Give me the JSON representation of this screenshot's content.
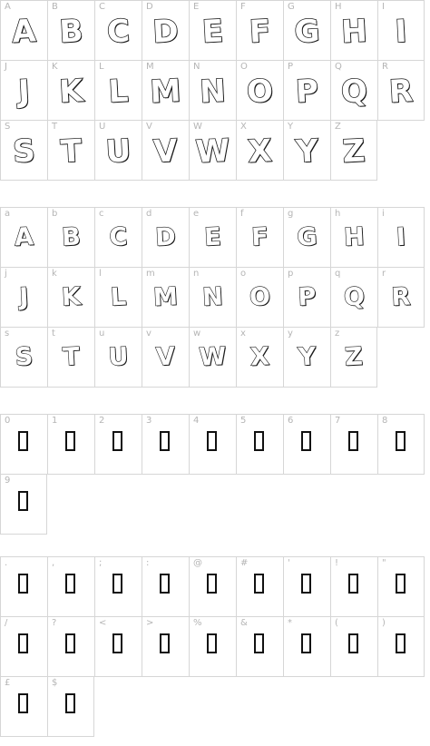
{
  "sections": [
    {
      "name": "uppercase-large",
      "glyph_size": "large",
      "cells": [
        {
          "key": "A",
          "glyph": "A"
        },
        {
          "key": "B",
          "glyph": "B"
        },
        {
          "key": "C",
          "glyph": "C"
        },
        {
          "key": "D",
          "glyph": "D"
        },
        {
          "key": "E",
          "glyph": "E"
        },
        {
          "key": "F",
          "glyph": "F"
        },
        {
          "key": "G",
          "glyph": "G"
        },
        {
          "key": "H",
          "glyph": "H"
        },
        {
          "key": "I",
          "glyph": "I"
        },
        {
          "key": "J",
          "glyph": "J"
        },
        {
          "key": "K",
          "glyph": "K"
        },
        {
          "key": "L",
          "glyph": "L"
        },
        {
          "key": "M",
          "glyph": "M"
        },
        {
          "key": "N",
          "glyph": "N"
        },
        {
          "key": "O",
          "glyph": "O"
        },
        {
          "key": "P",
          "glyph": "P"
        },
        {
          "key": "Q",
          "glyph": "Q"
        },
        {
          "key": "R",
          "glyph": "R"
        },
        {
          "key": "S",
          "glyph": "S"
        },
        {
          "key": "T",
          "glyph": "T"
        },
        {
          "key": "U",
          "glyph": "U"
        },
        {
          "key": "V",
          "glyph": "V"
        },
        {
          "key": "W",
          "glyph": "W"
        },
        {
          "key": "X",
          "glyph": "X"
        },
        {
          "key": "Y",
          "glyph": "Y"
        },
        {
          "key": "Z",
          "glyph": "Z"
        }
      ]
    },
    {
      "name": "lowercase-small",
      "glyph_size": "small",
      "cells": [
        {
          "key": "a",
          "glyph": "A"
        },
        {
          "key": "b",
          "glyph": "B"
        },
        {
          "key": "c",
          "glyph": "C"
        },
        {
          "key": "d",
          "glyph": "D"
        },
        {
          "key": "e",
          "glyph": "E"
        },
        {
          "key": "f",
          "glyph": "F"
        },
        {
          "key": "g",
          "glyph": "G"
        },
        {
          "key": "h",
          "glyph": "H"
        },
        {
          "key": "i",
          "glyph": "I"
        },
        {
          "key": "j",
          "glyph": "J"
        },
        {
          "key": "k",
          "glyph": "K"
        },
        {
          "key": "l",
          "glyph": "L"
        },
        {
          "key": "m",
          "glyph": "M"
        },
        {
          "key": "n",
          "glyph": "N"
        },
        {
          "key": "o",
          "glyph": "O"
        },
        {
          "key": "p",
          "glyph": "P"
        },
        {
          "key": "q",
          "glyph": "Q"
        },
        {
          "key": "r",
          "glyph": "R"
        },
        {
          "key": "s",
          "glyph": "S"
        },
        {
          "key": "t",
          "glyph": "T"
        },
        {
          "key": "u",
          "glyph": "U"
        },
        {
          "key": "v",
          "glyph": "V"
        },
        {
          "key": "w",
          "glyph": "W"
        },
        {
          "key": "x",
          "glyph": "X"
        },
        {
          "key": "y",
          "glyph": "Y"
        },
        {
          "key": "z",
          "glyph": "Z"
        }
      ]
    },
    {
      "name": "digits",
      "glyph_size": "missing",
      "cells": [
        {
          "key": "0"
        },
        {
          "key": "1"
        },
        {
          "key": "2"
        },
        {
          "key": "3"
        },
        {
          "key": "4"
        },
        {
          "key": "5"
        },
        {
          "key": "6"
        },
        {
          "key": "7"
        },
        {
          "key": "8"
        },
        {
          "key": "9"
        }
      ]
    },
    {
      "name": "punctuation",
      "glyph_size": "missing",
      "cells": [
        {
          "key": "."
        },
        {
          "key": ","
        },
        {
          "key": ";"
        },
        {
          "key": ":"
        },
        {
          "key": "@"
        },
        {
          "key": "#"
        },
        {
          "key": "'"
        },
        {
          "key": "!"
        },
        {
          "key": "\""
        },
        {
          "key": "/"
        },
        {
          "key": "?"
        },
        {
          "key": "<"
        },
        {
          "key": ">"
        },
        {
          "key": "%"
        },
        {
          "key": "&"
        },
        {
          "key": "*"
        },
        {
          "key": "("
        },
        {
          "key": ")"
        },
        {
          "key": "£"
        },
        {
          "key": "$"
        }
      ]
    }
  ],
  "colors": {
    "grid_line": "#d6d6d6",
    "key_label": "#b5b5b5",
    "glyph_outline": "#1a1a1a",
    "glyph_fill": "#ffffff"
  }
}
